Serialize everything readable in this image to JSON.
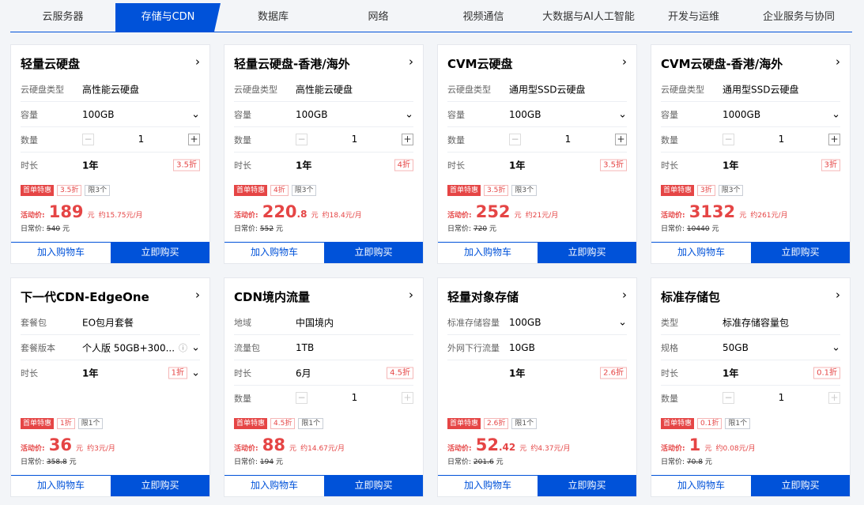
{
  "tabs": [
    "云服务器",
    "存储与CDN",
    "数据库",
    "网络",
    "视频通信",
    "大数据与AI人工智能",
    "开发与运维",
    "企业服务与协同"
  ],
  "common": {
    "cart": "加入购物车",
    "buy": "立即购买",
    "first_badge": "首单特惠",
    "activity_label": "活动价:",
    "original_label": "日常价:",
    "yuan": "元",
    "minus": "−",
    "plus": "+",
    "arrow": "›",
    "chevron": "⌄",
    "info_icon": "ⓘ"
  },
  "cards": [
    {
      "title": "轻量云硬盘",
      "rows": [
        {
          "label": "云硬盘类型",
          "value": "高性能云硬盘"
        },
        {
          "label": "容量",
          "value": "100GB"
        },
        {
          "label": "数量",
          "value": "1"
        },
        {
          "label": "时长",
          "value": "1年",
          "discount": "3.5折"
        }
      ],
      "badge_discount": "3.5折",
      "badge_limit": "限3个",
      "price_int": "189",
      "price_dec": "",
      "per_month": "约15.75元/月",
      "original": "540"
    },
    {
      "title": "轻量云硬盘-香港/海外",
      "rows": [
        {
          "label": "云硬盘类型",
          "value": "高性能云硬盘"
        },
        {
          "label": "容量",
          "value": "100GB"
        },
        {
          "label": "数量",
          "value": "1"
        },
        {
          "label": "时长",
          "value": "1年",
          "discount": "4折"
        }
      ],
      "badge_discount": "4折",
      "badge_limit": "限3个",
      "price_int": "220",
      "price_dec": ".8",
      "per_month": "约18.4元/月",
      "original": "552"
    },
    {
      "title": "CVM云硬盘",
      "rows": [
        {
          "label": "云硬盘类型",
          "value": "通用型SSD云硬盘"
        },
        {
          "label": "容量",
          "value": "100GB"
        },
        {
          "label": "数量",
          "value": "1"
        },
        {
          "label": "时长",
          "value": "1年",
          "discount": "3.5折"
        }
      ],
      "badge_discount": "3.5折",
      "badge_limit": "限3个",
      "price_int": "252",
      "price_dec": "",
      "per_month": "约21元/月",
      "original": "720"
    },
    {
      "title": "CVM云硬盘-香港/海外",
      "rows": [
        {
          "label": "云硬盘类型",
          "value": "通用型SSD云硬盘"
        },
        {
          "label": "容量",
          "value": "1000GB"
        },
        {
          "label": "数量",
          "value": "1"
        },
        {
          "label": "时长",
          "value": "1年",
          "discount": "3折"
        }
      ],
      "badge_discount": "3折",
      "badge_limit": "限3个",
      "price_int": "3132",
      "price_dec": "",
      "per_month": "约261元/月",
      "original": "10440"
    },
    {
      "title": "下一代CDN-EdgeOne",
      "rows": [
        {
          "label": "套餐包",
          "value": "EO包月套餐"
        },
        {
          "label": "套餐版本",
          "value": "个人版 50GB+300..."
        },
        {
          "label": "时长",
          "value": "1年",
          "discount": "1折"
        }
      ],
      "badge_discount": "1折",
      "badge_limit": "限1个",
      "price_int": "36",
      "price_dec": "",
      "per_month": "约3元/月",
      "original": "358.8"
    },
    {
      "title": "CDN境内流量",
      "rows": [
        {
          "label": "地域",
          "value": "中国境内"
        },
        {
          "label": "流量包",
          "value": "1TB"
        },
        {
          "label": "时长",
          "value": "6月",
          "discount": "4.5折"
        },
        {
          "label": "数量",
          "value": "1"
        }
      ],
      "badge_discount": "4.5折",
      "badge_limit": "限1个",
      "price_int": "88",
      "price_dec": "",
      "per_month": "约14.67元/月",
      "original": "194"
    },
    {
      "title": "轻量对象存储",
      "rows": [
        {
          "label": "标准存储容量",
          "value": "100GB"
        },
        {
          "label": "外网下行流量",
          "value": "10GB"
        },
        {
          "label": "",
          "value": "1年",
          "discount": "2.6折"
        }
      ],
      "badge_discount": "2.6折",
      "badge_limit": "限1个",
      "price_int": "52",
      "price_dec": ".42",
      "per_month": "约4.37元/月",
      "original": "201.6"
    },
    {
      "title": "标准存储包",
      "rows": [
        {
          "label": "类型",
          "value": "标准存储容量包"
        },
        {
          "label": "规格",
          "value": "50GB"
        },
        {
          "label": "时长",
          "value": "1年",
          "discount": "0.1折"
        },
        {
          "label": "数量",
          "value": "1"
        }
      ],
      "badge_discount": "0.1折",
      "badge_limit": "限1个",
      "price_int": "1",
      "price_dec": "",
      "per_month": "约0.08元/月",
      "original": "70.8"
    }
  ]
}
